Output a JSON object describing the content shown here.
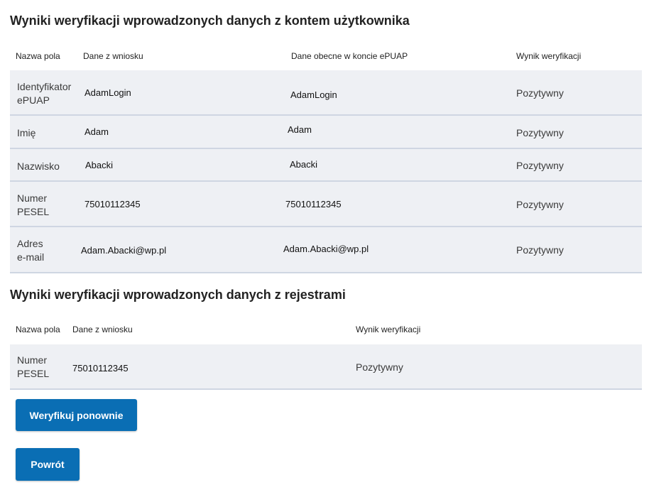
{
  "section1": {
    "title": "Wyniki weryfikacji wprowadzonych danych z kontem użytkownika",
    "headers": {
      "field": "Nazwa pola",
      "from_request": "Dane z wniosku",
      "current_in_account": "Dane obecne w koncie ePUAP",
      "result": "Wynik weryfikacji"
    },
    "rows": [
      {
        "field": "Identyfikator\nePUAP",
        "from_request": "AdamLogin",
        "current": "AdamLogin",
        "result": "Pozytywny"
      },
      {
        "field": "Imię",
        "from_request": "Adam",
        "current": "Adam",
        "result": "Pozytywny"
      },
      {
        "field": "Nazwisko",
        "from_request": "Abacki",
        "current": "Abacki",
        "result": "Pozytywny"
      },
      {
        "field": "Numer\nPESEL",
        "from_request": "75010112345",
        "current": "75010112345",
        "result": "Pozytywny"
      },
      {
        "field": "Adres\ne-mail",
        "from_request": "Adam.Abacki@wp.pl",
        "current": "Adam.Abacki@wp.pl",
        "result": "Pozytywny"
      }
    ]
  },
  "section2": {
    "title": "Wyniki weryfikacji wprowadzonych danych z rejestrami",
    "headers": {
      "field": "Nazwa pola",
      "from_request": "Dane z wniosku",
      "result": "Wynik weryfikacji"
    },
    "rows": [
      {
        "field": "Numer\nPESEL",
        "from_request": "75010112345",
        "result": "Pozytywny"
      }
    ]
  },
  "buttons": {
    "verify_again": "Weryfikuj ponownie",
    "back": "Powrót"
  },
  "colors": {
    "button": "#0a6eb4",
    "row_background": "#eef0f4",
    "row_border": "#cfd6e2"
  }
}
